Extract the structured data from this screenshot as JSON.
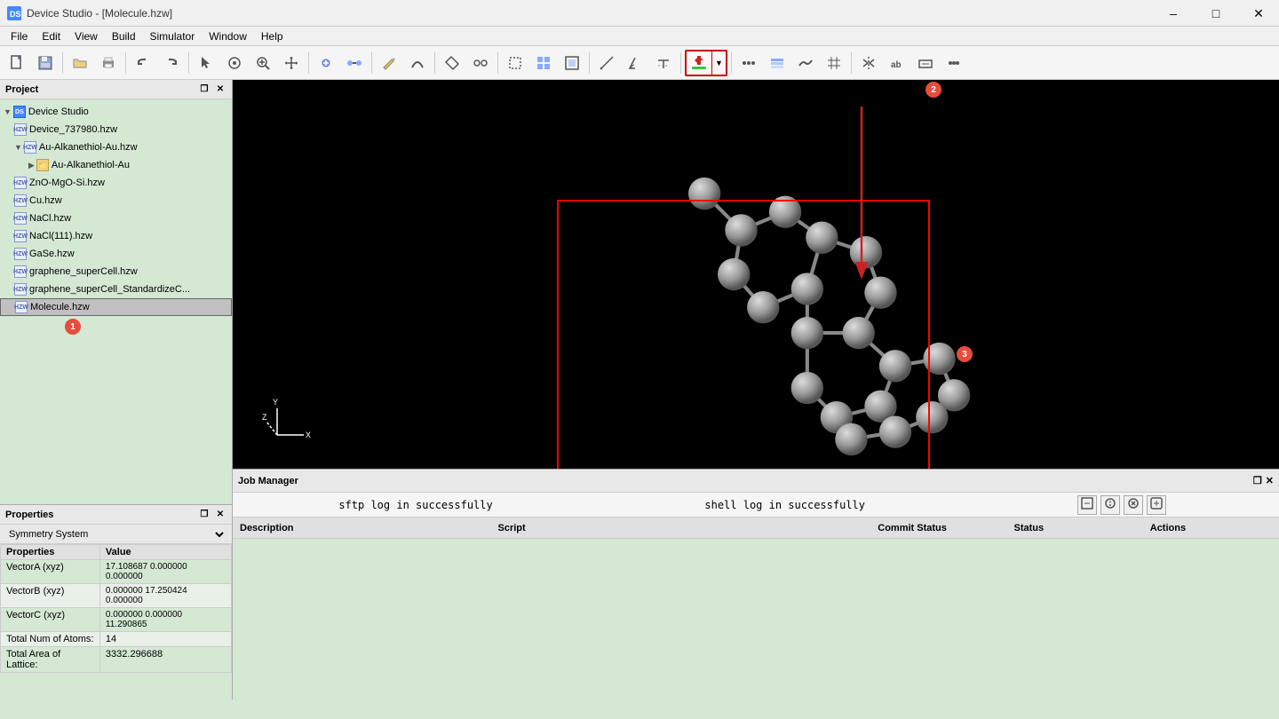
{
  "titleBar": {
    "icon": "DS",
    "title": "Device Studio - [Molecule.hzw]",
    "controls": [
      "minimize",
      "maximize",
      "close"
    ]
  },
  "menuBar": {
    "items": [
      "File",
      "Edit",
      "View",
      "Build",
      "Simulator",
      "Window",
      "Help"
    ]
  },
  "toolbar": {
    "groups": [
      [
        "new",
        "open",
        "save"
      ],
      [
        "undo",
        "redo"
      ],
      [
        "select",
        "rotate",
        "zoom",
        "translate"
      ],
      [
        "atom-add",
        "bond-add"
      ],
      [
        "supercell",
        "grid"
      ],
      [
        "import",
        "export"
      ],
      [
        "measure"
      ],
      [
        "symmetry"
      ],
      [
        "download-button"
      ],
      [
        "arrange"
      ],
      [
        "label",
        "text"
      ]
    ]
  },
  "project": {
    "title": "Project",
    "items": [
      {
        "id": "device-studio",
        "label": "Device Studio",
        "type": "root",
        "indent": 0,
        "expanded": true
      },
      {
        "id": "device-737980",
        "label": "Device_737980.hzw",
        "type": "hzw",
        "indent": 1
      },
      {
        "id": "au-alkanethiol",
        "label": "Au-Alkanethiol-Au.hzw",
        "type": "hzw",
        "indent": 1,
        "expanded": true
      },
      {
        "id": "au-alkanethiol-folder",
        "label": "Au-Alkanethiol-Au",
        "type": "folder",
        "indent": 2
      },
      {
        "id": "zno-mgosi",
        "label": "ZnO-MgO-Si.hzw",
        "type": "hzw",
        "indent": 1
      },
      {
        "id": "cu",
        "label": "Cu.hzw",
        "type": "hzw",
        "indent": 1
      },
      {
        "id": "nacl",
        "label": "NaCl.hzw",
        "type": "hzw",
        "indent": 1
      },
      {
        "id": "nacl111",
        "label": "NaCl(111).hzw",
        "type": "hzw",
        "indent": 1
      },
      {
        "id": "gase",
        "label": "GaSe.hzw",
        "type": "hzw",
        "indent": 1
      },
      {
        "id": "graphene-super",
        "label": "graphene_superCell.hzw",
        "type": "hzw",
        "indent": 1
      },
      {
        "id": "graphene-std",
        "label": "graphene_superCell_StandardizeC...",
        "type": "hzw",
        "indent": 1
      },
      {
        "id": "molecule",
        "label": "Molecule.hzw",
        "type": "hzw",
        "indent": 1,
        "selected": true,
        "badge": "1"
      }
    ]
  },
  "properties": {
    "title": "Properties",
    "filter": "Symmetry System",
    "columns": [
      "Properties",
      "Value"
    ],
    "rows": [
      {
        "key": "VectorA (xyz)",
        "value": "17.108687 0.000000\n0.000000"
      },
      {
        "key": "VectorB (xyz)",
        "value": "0.000000 17.250424\n0.000000"
      },
      {
        "key": "VectorC (xyz)",
        "value": "0.000000 0.000000\n11.290865"
      },
      {
        "key": "Total Num of Atoms:",
        "value": "14"
      },
      {
        "key": "Total Area of Lattice:",
        "value": "3332.296688"
      }
    ]
  },
  "viewport": {
    "backgroundColor": "#000000",
    "moleculeColor": "#888888",
    "selectionBoxColor": "#ff0000",
    "annotations": [
      {
        "id": "badge1",
        "number": "1",
        "position": "bottom-left-tree"
      },
      {
        "id": "badge2",
        "number": "2",
        "position": "toolbar-highlight"
      },
      {
        "id": "badge3",
        "number": "3",
        "position": "viewport-right"
      }
    ]
  },
  "jobManager": {
    "title": "Job Manager",
    "statusBar": {
      "sftp": "sftp log in successfully",
      "shell": "shell log in successfully"
    },
    "table": {
      "columns": [
        "Description",
        "Script",
        "Commit Status",
        "Status",
        "Actions"
      ]
    }
  },
  "statusBar": {
    "text": ""
  }
}
